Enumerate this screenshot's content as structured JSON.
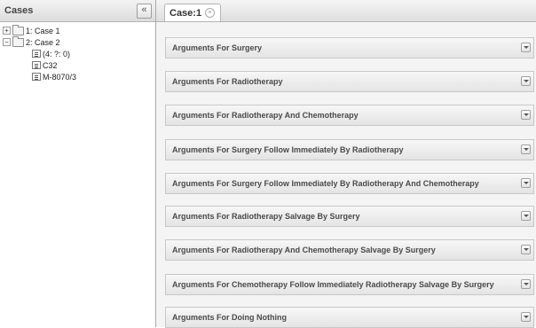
{
  "left_panel": {
    "title": "Cases",
    "collapse_glyph": "«"
  },
  "tree": {
    "case1": {
      "toggle": "+",
      "label": "1: Case 1"
    },
    "case2": {
      "toggle": "−",
      "label": "2: Case 2"
    },
    "children": [
      "(4: ?: 0)",
      "C32",
      "M-8070/3"
    ]
  },
  "tabs": [
    {
      "label": "Case:1",
      "close_glyph": "×"
    }
  ],
  "sections": [
    "Arguments For Surgery",
    "Arguments For Radiotherapy",
    "Arguments For Radiotherapy And Chemotherapy",
    "Arguments For Surgery Follow Immediately By Radiotherapy",
    "Arguments For Surgery Follow Immediately By Radiotherapy And Chemotherapy",
    "Arguments For Radiotherapy Salvage By Surgery",
    "Arguments For Radiotherapy And Chemotherapy Salvage By Surgery",
    "Arguments For Chemotherapy Follow Immediately Radiotherapy Salvage By Surgery",
    "Arguments For Doing Nothing"
  ],
  "icons": {
    "collapse": "double-chevron-left-icon",
    "expand_section": "chevron-down-icon",
    "folder": "folder-icon",
    "leaf": "document-icon",
    "tab_close": "close-icon"
  }
}
